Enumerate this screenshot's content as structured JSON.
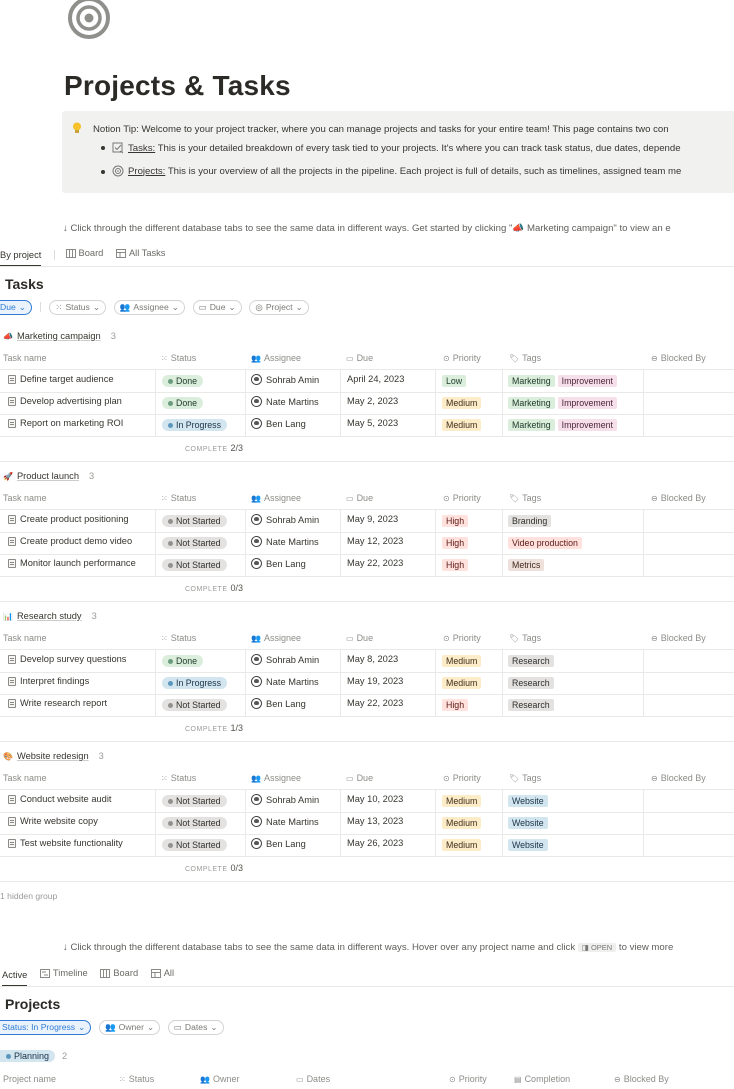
{
  "page": {
    "title": "Projects & Tasks",
    "callout": {
      "lead_label": "Notion Tip:",
      "lead_text": " Welcome to your project tracker, where you can manage projects and tasks for your entire team! This page contains two con",
      "bullets": [
        {
          "link": "Tasks:",
          "text": " This is your detailed breakdown of every task tied to your projects. It's where you can track task status, due dates, depende",
          "icon": "checkbox-icon"
        },
        {
          "link": "Projects:",
          "text": " This is your overview of all the projects in the pipeline. Each project is full of details, such as timelines, assigned team me",
          "icon": "target-icon"
        }
      ]
    },
    "hint1": "↓ Click through the different database tabs to see the same data in different ways. Get started by clicking \"📣 Marketing campaign\" to view an e",
    "hint2_before": "↓ Click through the different database tabs to see the same data in different ways. Hover over any project name and click ",
    "hint2_code": "◨ OPEN",
    "hint2_after": " to view more"
  },
  "tasks_db": {
    "tabs": [
      "By project",
      "Board",
      "All Tasks"
    ],
    "title": "Tasks",
    "filters": [
      "Due",
      "Status",
      "Assignee",
      "Due",
      "Project"
    ],
    "columns": [
      "Task name",
      "Status",
      "Assignee",
      "Due",
      "Priority",
      "Tags",
      "Blocked By"
    ],
    "complete_label": "COMPLETE",
    "hidden_groups": "1 hidden group",
    "groups": [
      {
        "name": "Marketing campaign",
        "icon": "megaphone-icon",
        "count": "3",
        "complete": "2/3",
        "rows": [
          {
            "name": "Define target audience",
            "status": "Done",
            "assignee": "Sohrab Amin",
            "due": "April 24, 2023",
            "priority": "Low",
            "tags": [
              "Marketing",
              "Improvement"
            ]
          },
          {
            "name": "Develop advertising plan",
            "status": "Done",
            "assignee": "Nate Martins",
            "due": "May 2, 2023",
            "priority": "Medium",
            "tags": [
              "Marketing",
              "Improvement"
            ]
          },
          {
            "name": "Report on marketing ROI",
            "status": "In Progress",
            "assignee": "Ben Lang",
            "due": "May 5, 2023",
            "priority": "Medium",
            "tags": [
              "Marketing",
              "Improvement"
            ]
          }
        ]
      },
      {
        "name": "Product launch",
        "icon": "rocket-icon",
        "count": "3",
        "complete": "0/3",
        "rows": [
          {
            "name": "Create product positioning",
            "status": "Not Started",
            "assignee": "Sohrab Amin",
            "due": "May 9, 2023",
            "priority": "High",
            "tags": [
              "Branding"
            ]
          },
          {
            "name": "Create product demo video",
            "status": "Not Started",
            "assignee": "Nate Martins",
            "due": "May 12, 2023",
            "priority": "High",
            "tags": [
              "Video production"
            ]
          },
          {
            "name": "Monitor launch performance",
            "status": "Not Started",
            "assignee": "Ben Lang",
            "due": "May 22, 2023",
            "priority": "High",
            "tags": [
              "Metrics"
            ]
          }
        ]
      },
      {
        "name": "Research study",
        "icon": "chart-icon",
        "count": "3",
        "complete": "1/3",
        "rows": [
          {
            "name": "Develop survey questions",
            "status": "Done",
            "assignee": "Sohrab Amin",
            "due": "May 8, 2023",
            "priority": "Medium",
            "tags": [
              "Research"
            ]
          },
          {
            "name": "Interpret findings",
            "status": "In Progress",
            "assignee": "Nate Martins",
            "due": "May 19, 2023",
            "priority": "Medium",
            "tags": [
              "Research"
            ]
          },
          {
            "name": "Write research report",
            "status": "Not Started",
            "assignee": "Ben Lang",
            "due": "May 22, 2023",
            "priority": "High",
            "tags": [
              "Research"
            ]
          }
        ]
      },
      {
        "name": "Website redesign",
        "icon": "palette-icon",
        "count": "3",
        "complete": "0/3",
        "rows": [
          {
            "name": "Conduct website audit",
            "status": "Not Started",
            "assignee": "Sohrab Amin",
            "due": "May 10, 2023",
            "priority": "Medium",
            "tags": [
              "Website"
            ]
          },
          {
            "name": "Write website copy",
            "status": "Not Started",
            "assignee": "Nate Martins",
            "due": "May 13, 2023",
            "priority": "Medium",
            "tags": [
              "Website"
            ]
          },
          {
            "name": "Test website functionality",
            "status": "Not Started",
            "assignee": "Ben Lang",
            "due": "May 26, 2023",
            "priority": "Medium",
            "tags": [
              "Website"
            ]
          }
        ]
      }
    ]
  },
  "projects_db": {
    "tabs": [
      "Active",
      "Timeline",
      "Board",
      "All"
    ],
    "title": "Projects",
    "filters": [
      "Status: In Progress",
      "Owner",
      "Dates"
    ],
    "group": {
      "name": "Planning",
      "count": "2"
    },
    "columns": [
      "Project name",
      "Status",
      "Owner",
      "Dates",
      "Priority",
      "Completion",
      "Blocked By"
    ]
  },
  "colors": {
    "status": {
      "Done": [
        "#dbeddb",
        "#1c3829",
        "#6c9b7d"
      ],
      "In Progress": [
        "#d3e5ef",
        "#183347",
        "#5b97bd"
      ],
      "Not Started": [
        "#e3e2e0",
        "#32302c",
        "#91918e"
      ]
    },
    "priority": {
      "Low": [
        "#dbeddb",
        "#1c3829"
      ],
      "Medium": [
        "#fdecc8",
        "#402c1b"
      ],
      "High": [
        "#ffe2dd",
        "#5d1715"
      ]
    },
    "tags": {
      "Marketing": [
        "#dbeddb",
        "#1c3829"
      ],
      "Improvement": [
        "#f5e0e9",
        "#4c2337"
      ],
      "Branding": [
        "#e3e2e0",
        "#32302c"
      ],
      "Video production": [
        "#ffe2dd",
        "#5d1715"
      ],
      "Metrics": [
        "#eee0da",
        "#442a1e"
      ],
      "Research": [
        "#e3e2e0",
        "#32302c"
      ],
      "Website": [
        "#d3e5ef",
        "#183347"
      ]
    }
  }
}
